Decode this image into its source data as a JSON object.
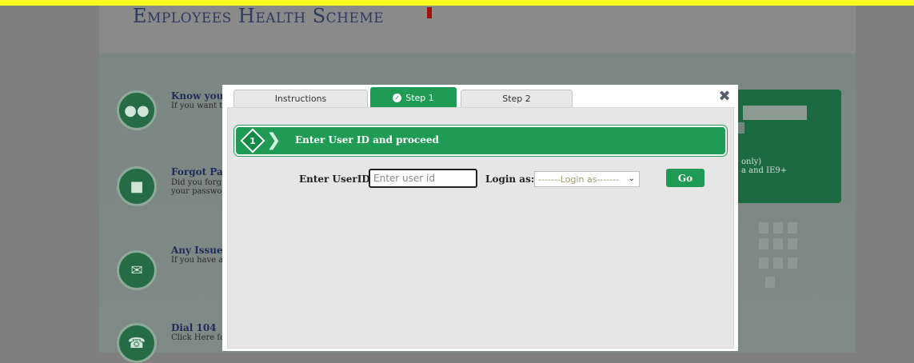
{
  "background": {
    "title": "Employees Health Scheme",
    "items": [
      {
        "title": "Know you",
        "desc": "If you want t",
        "icon": "users-icon"
      },
      {
        "title": "Forgot Pa",
        "desc": "Did you forg\nyour passwo",
        "icon": "lock-icon"
      },
      {
        "title": "Any Issue",
        "desc": "If you have a",
        "icon": "mail-pen-icon"
      },
      {
        "title": "Dial 104",
        "desc": "Click Here fo",
        "icon": "phone-icon"
      }
    ],
    "side_note": "only)\na and IE9+"
  },
  "modal": {
    "tabs": [
      {
        "label": "Instructions",
        "active": false
      },
      {
        "label": "Step 1",
        "active": true,
        "icon": "check-icon"
      },
      {
        "label": "Step 2",
        "active": false
      }
    ],
    "close_icon": "close-icon",
    "banner": {
      "step_number": "1",
      "text": "Enter User ID and proceed"
    },
    "form": {
      "userid_label": "Enter UserID:",
      "userid_placeholder": "Enter user id",
      "userid_value": "",
      "login_as_label": "Login as:",
      "login_as_selected": "-------Login as-------",
      "go_label": "Go"
    }
  },
  "colors": {
    "accent": "#1f9b55",
    "topbar": "#ffff22"
  }
}
